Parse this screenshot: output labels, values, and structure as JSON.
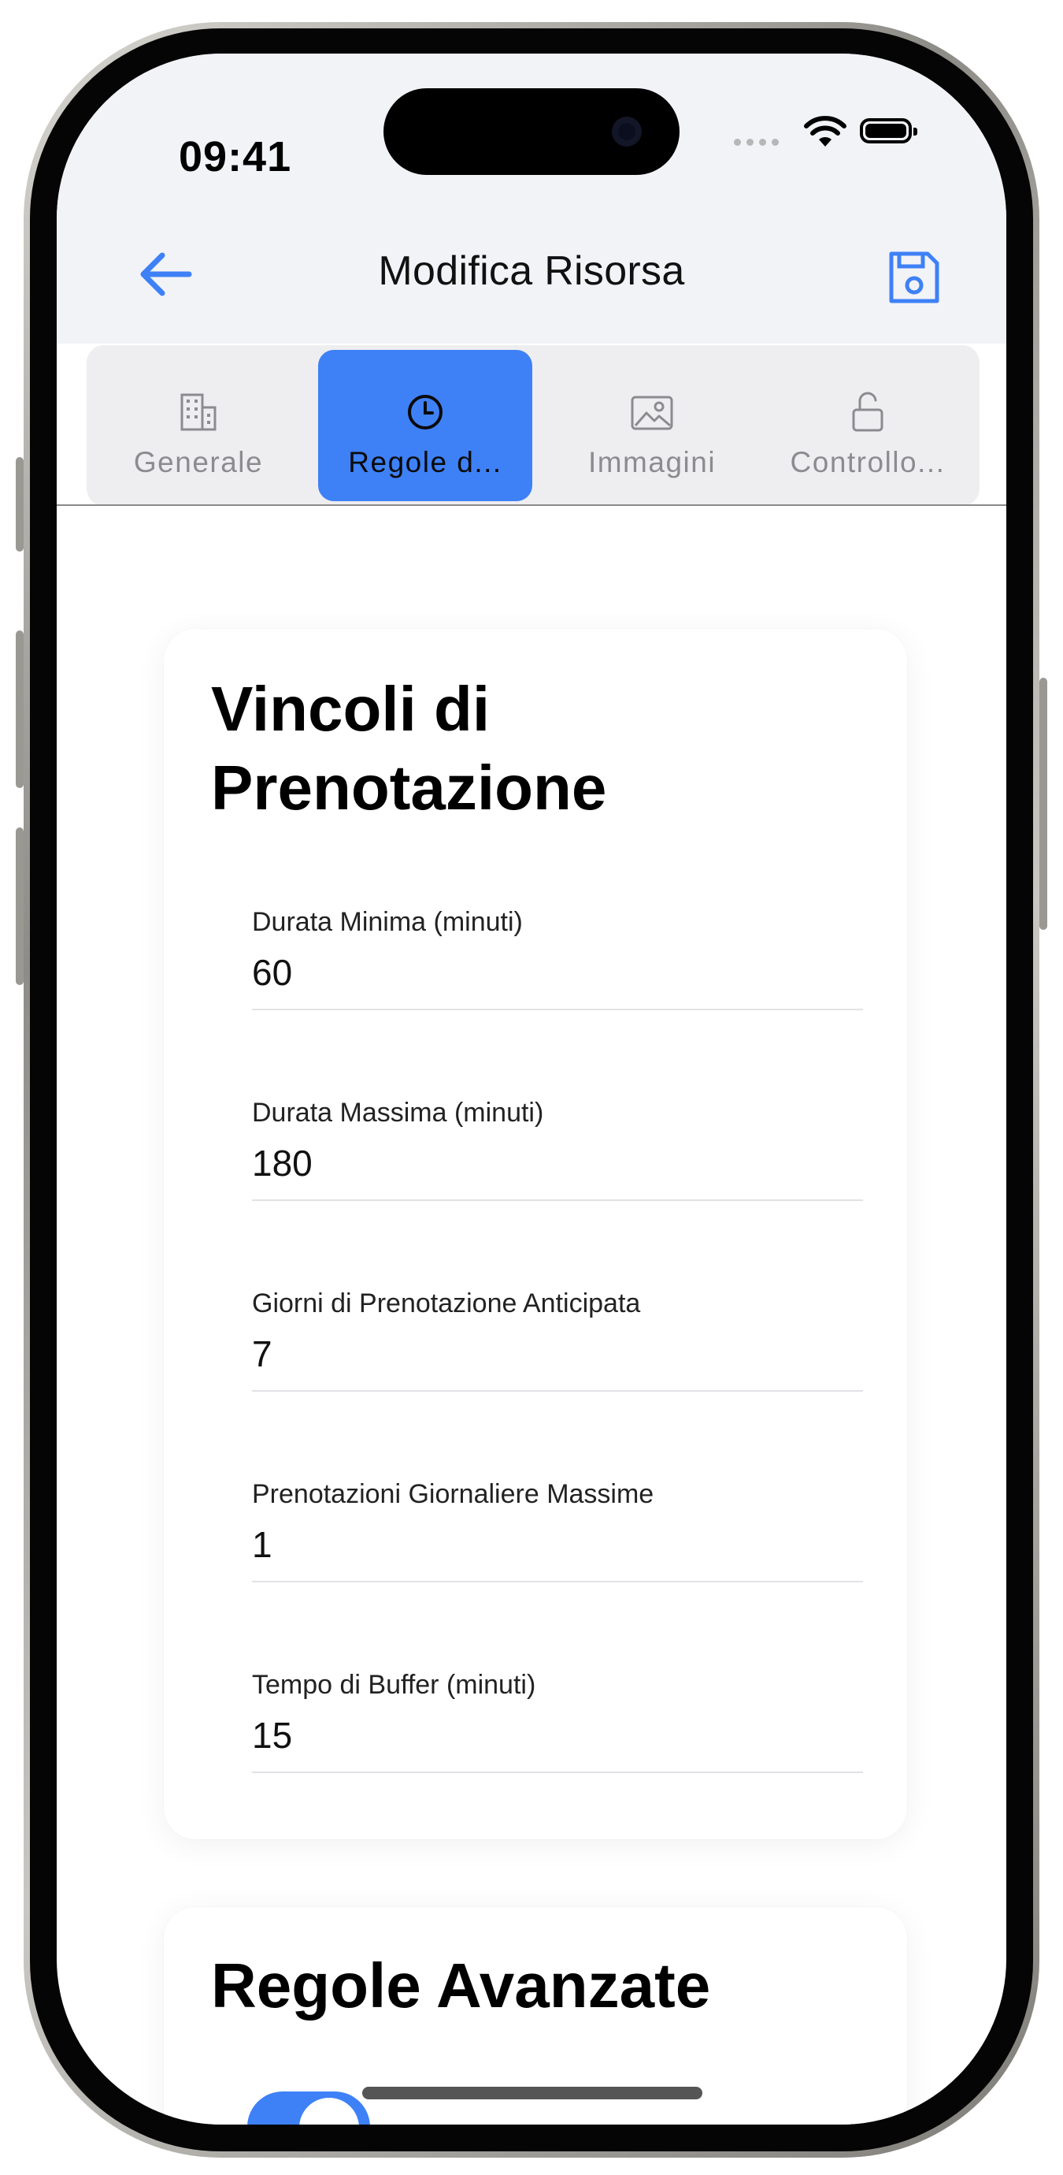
{
  "status_bar": {
    "time": "09:41"
  },
  "nav": {
    "title": "Modifica Risorsa",
    "back_icon": "arrow-left-icon",
    "save_icon": "floppy-disk-icon",
    "accent": "#3e81f6"
  },
  "tabs": [
    {
      "label": "Generale",
      "icon": "building-icon",
      "active": false
    },
    {
      "label": "Regole d...",
      "icon": "clock-icon",
      "active": true
    },
    {
      "label": "Immagini",
      "icon": "image-icon",
      "active": false
    },
    {
      "label": "Controllo...",
      "icon": "lock-open-icon",
      "active": false
    }
  ],
  "constraints_card": {
    "title": "Vincoli di Prenotazione",
    "fields": [
      {
        "label": "Durata Minima (minuti)",
        "value": "60"
      },
      {
        "label": "Durata Massima (minuti)",
        "value": "180"
      },
      {
        "label": "Giorni di Prenotazione Anticipata",
        "value": "7"
      },
      {
        "label": "Prenotazioni Giornaliere Massime",
        "value": "1"
      },
      {
        "label": "Tempo di Buffer (minuti)",
        "value": "15"
      }
    ]
  },
  "advanced_card": {
    "title": "Regole Avanzate",
    "toggle_on": true
  }
}
